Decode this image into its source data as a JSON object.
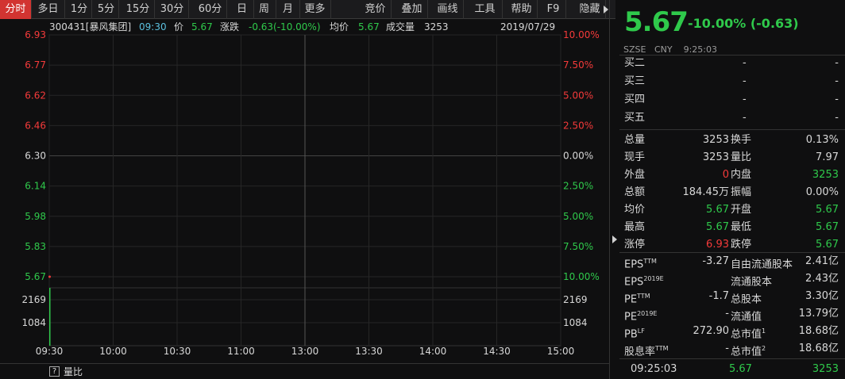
{
  "toolbar": {
    "items": [
      "分时",
      "多日",
      "1分",
      "5分",
      "15分",
      "30分",
      "60分",
      "日",
      "周",
      "月",
      "更多",
      "竞价",
      "叠加",
      "画线",
      "工具",
      "帮助",
      "F9",
      "隐藏"
    ]
  },
  "info": {
    "code": "300431[暴风集团]",
    "time": "09:30",
    "price_label": "价",
    "price": "5.67",
    "change_label": "涨跌",
    "change": "-0.63(-10.00%)",
    "avg_label": "均价",
    "avg": "5.67",
    "vol_label": "成交量",
    "vol": "3253",
    "date": "2019/07/29"
  },
  "chart_data": {
    "type": "line",
    "left_ticks": [
      "6.93",
      "6.77",
      "6.62",
      "6.46",
      "6.30",
      "6.14",
      "5.98",
      "5.83",
      "5.67"
    ],
    "right_ticks": [
      "10.00%",
      "7.50%",
      "5.00%",
      "2.50%",
      "0.00%",
      "2.50%",
      "5.00%",
      "7.50%",
      "10.00%"
    ],
    "volume_ticks_left": [
      "2169",
      "1084"
    ],
    "volume_ticks_right": [
      "2169",
      "1084"
    ],
    "x_ticks": [
      "09:30",
      "10:00",
      "10:30",
      "11:00",
      "13:00",
      "13:30",
      "14:00",
      "14:30",
      "15:00"
    ],
    "ylim": [
      5.67,
      6.93
    ],
    "prev_close": 6.3,
    "series": [
      {
        "values": [
          {
            "x": "09:30",
            "y": 5.67
          }
        ]
      }
    ],
    "volume": [
      {
        "x": "09:30",
        "v": 3253
      }
    ],
    "volume_max": 3253
  },
  "bottom": {
    "help": "?",
    "label": "量比"
  },
  "panel": {
    "price": "5.67",
    "change": "-10.00% (-0.63)",
    "exchange": "SZSE",
    "currency": "CNY",
    "time": "9:25:03",
    "bids": [
      {
        "label": "买二",
        "price": "-",
        "vol": "-"
      },
      {
        "label": "买三",
        "price": "-",
        "vol": "-"
      },
      {
        "label": "买四",
        "price": "-",
        "vol": "-"
      },
      {
        "label": "买五",
        "price": "-",
        "vol": "-"
      }
    ],
    "stats": [
      {
        "l1": "总量",
        "v1": "3253",
        "l2": "换手",
        "v2": "0.13%",
        "c1": "wht",
        "c2": "wht"
      },
      {
        "l1": "现手",
        "v1": "3253",
        "l2": "量比",
        "v2": "7.97",
        "c1": "wht",
        "c2": "wht"
      },
      {
        "l1": "外盘",
        "v1": "0",
        "l2": "内盘",
        "v2": "3253",
        "c1": "red",
        "c2": "grn"
      },
      {
        "l1": "总额",
        "v1": "184.45万",
        "l2": "振幅",
        "v2": "0.00%",
        "c1": "wht",
        "c2": "wht"
      },
      {
        "l1": "均价",
        "v1": "5.67",
        "l2": "开盘",
        "v2": "5.67",
        "c1": "grn",
        "c2": "grn"
      },
      {
        "l1": "最高",
        "v1": "5.67",
        "l2": "最低",
        "v2": "5.67",
        "c1": "grn",
        "c2": "grn"
      },
      {
        "l1": "涨停",
        "v1": "6.93",
        "l2": "跌停",
        "v2": "5.67",
        "c1": "red",
        "c2": "grn"
      }
    ],
    "fundamentals": [
      {
        "l1": "EPS",
        "s1": "TTM",
        "v1": "-3.27",
        "l2": "自由流通股本",
        "s2": "",
        "v2": "2.41亿"
      },
      {
        "l1": "EPS",
        "s1": "2019E",
        "v1": "",
        "l2": "流通股本",
        "s2": "",
        "v2": "2.43亿"
      },
      {
        "l1": "PE",
        "s1": "TTM",
        "v1": "-1.7",
        "l2": "总股本",
        "s2": "",
        "v2": "3.30亿"
      },
      {
        "l1": "PE",
        "s1": "2019E",
        "v1": "-",
        "l2": "流通值",
        "s2": "",
        "v2": "13.79亿"
      },
      {
        "l1": "PB",
        "s1": "LF",
        "v1": "272.90",
        "l2": "总市值",
        "s2": "1",
        "v2": "18.68亿"
      },
      {
        "l1": "股息率",
        "s1": "TTM",
        "v1": "-",
        "l2": "总市值",
        "s2": "2",
        "v2": "18.68亿"
      }
    ],
    "last_trade": {
      "time": "09:25:03",
      "price": "5.67",
      "vol": "3253"
    }
  },
  "colors": {
    "up": "#f53a3a",
    "down": "#2fc94b",
    "neutral": "#d8d8d8",
    "accent": "#d23431"
  }
}
